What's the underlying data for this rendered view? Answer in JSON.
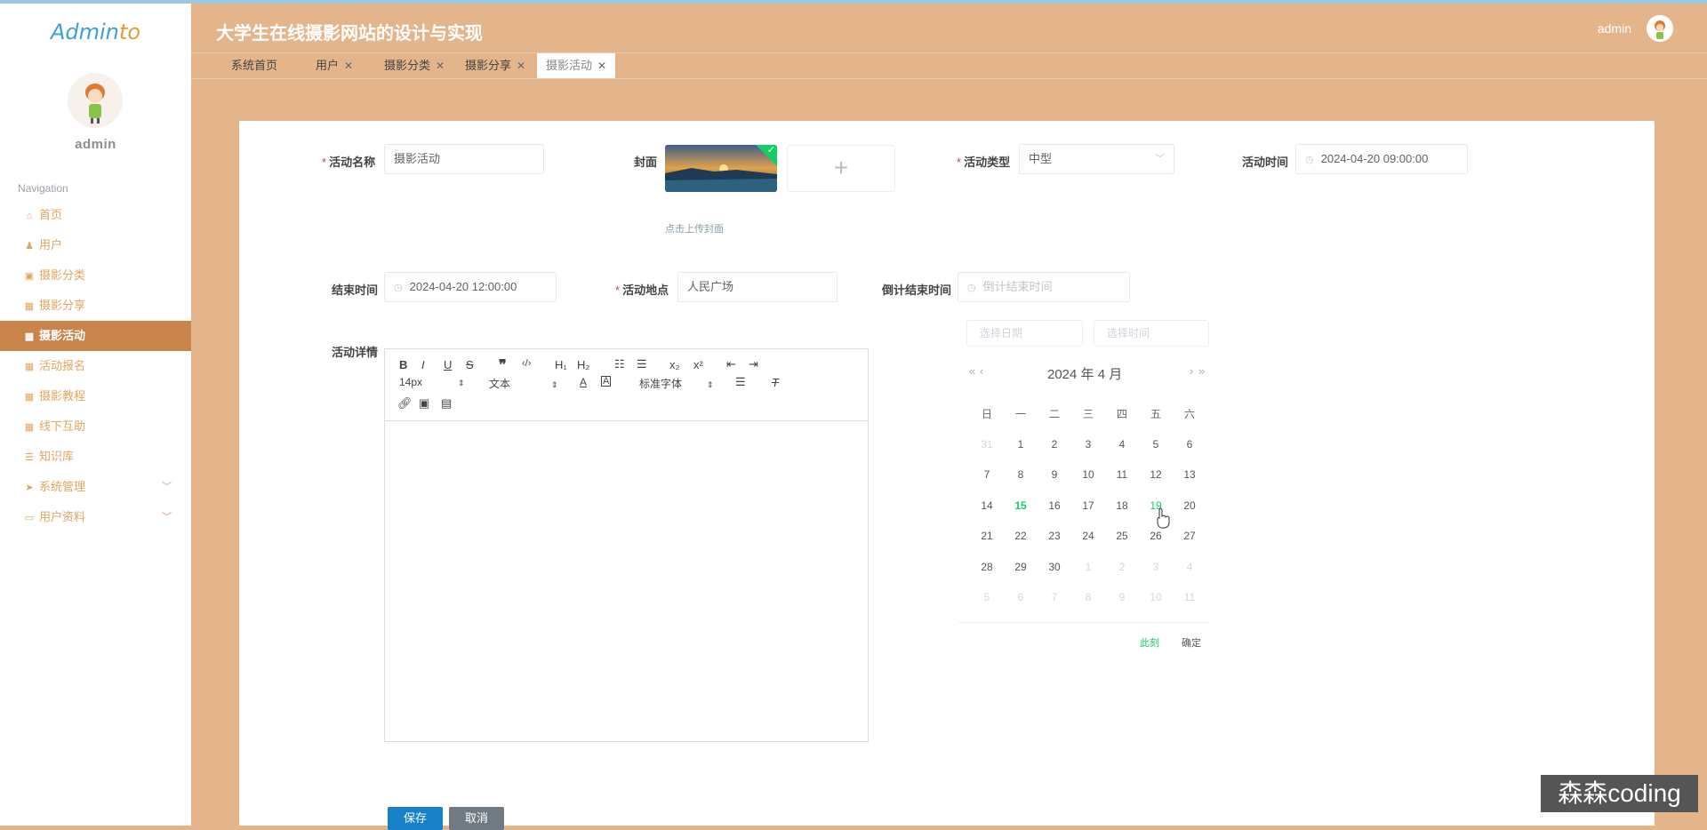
{
  "app": {
    "title": "大学生在线摄影网站的设计与实现",
    "logo_part1": "Admin",
    "logo_part2": "to"
  },
  "sidebar": {
    "username": "admin",
    "nav_title": "Navigation",
    "items": [
      {
        "label": "首页",
        "icon": "home-icon",
        "glyph": "⌂"
      },
      {
        "label": "用户",
        "icon": "user-icon",
        "glyph": "♟"
      },
      {
        "label": "摄影分类",
        "icon": "grid-icon",
        "glyph": "▣"
      },
      {
        "label": "摄影分享",
        "icon": "grid-icon",
        "glyph": "▦"
      },
      {
        "label": "摄影活动",
        "icon": "grid-icon",
        "glyph": "▦",
        "active": true
      },
      {
        "label": "活动报名",
        "icon": "grid-icon",
        "glyph": "▦"
      },
      {
        "label": "摄影教程",
        "icon": "grid-icon",
        "glyph": "▦"
      },
      {
        "label": "线下互助",
        "icon": "grid-icon",
        "glyph": "▦"
      },
      {
        "label": "知识库",
        "icon": "list-icon",
        "glyph": "☰"
      },
      {
        "label": "系统管理",
        "icon": "send-icon",
        "glyph": "➤",
        "expandable": true
      },
      {
        "label": "用户资料",
        "icon": "card-icon",
        "glyph": "▭",
        "expandable": true
      }
    ]
  },
  "header": {
    "username": "admin"
  },
  "tabs": [
    {
      "label": "系统首页",
      "closable": false
    },
    {
      "label": "用户",
      "closable": true
    },
    {
      "label": "摄影分类",
      "closable": true
    },
    {
      "label": "摄影分享",
      "closable": true
    },
    {
      "label": "摄影活动",
      "closable": true,
      "active": true
    }
  ],
  "form": {
    "name_label": "活动名称",
    "name_value": "摄影活动",
    "cover_label": "封面",
    "cover_hint": "点击上传封面",
    "type_label": "活动类型",
    "type_value": "中型",
    "time_label": "活动时间",
    "time_value": "2024-04-20 09:00:00",
    "end_label": "结束时间",
    "end_value": "2024-04-20 12:00:00",
    "place_label": "活动地点",
    "place_value": "人民广场",
    "countdown_label": "倒计结束时间",
    "countdown_placeholder": "倒计结束时间",
    "detail_label": "活动详情",
    "save_label": "保存",
    "cancel_label": "取消"
  },
  "editor": {
    "font_size": "14px",
    "heading": "文本",
    "font_family": "标准字体",
    "h1": "H₁",
    "h2": "H₂",
    "sub": "x₂",
    "sup": "x²"
  },
  "datepicker": {
    "date_placeholder": "选择日期",
    "time_placeholder": "选择时间",
    "title": "2024 年  4 月",
    "weekdays": [
      "日",
      "一",
      "二",
      "三",
      "四",
      "五",
      "六"
    ],
    "weeks": [
      [
        "31",
        "1",
        "2",
        "3",
        "4",
        "5",
        "6"
      ],
      [
        "7",
        "8",
        "9",
        "10",
        "11",
        "12",
        "13"
      ],
      [
        "14",
        "15",
        "16",
        "17",
        "18",
        "19",
        "20"
      ],
      [
        "21",
        "22",
        "23",
        "24",
        "25",
        "26",
        "27"
      ],
      [
        "28",
        "29",
        "30",
        "1",
        "2",
        "3",
        "4"
      ],
      [
        "5",
        "6",
        "7",
        "8",
        "9",
        "10",
        "11"
      ]
    ],
    "today": "15",
    "hovered": "19",
    "now_label": "此刻",
    "confirm_label": "确定"
  },
  "watermark": "森森coding",
  "colors": {
    "header": "#e4b48a",
    "active_nav": "#c8844a",
    "primary": "#1880c9",
    "success": "#13ce66",
    "info": "#6f7a82"
  }
}
